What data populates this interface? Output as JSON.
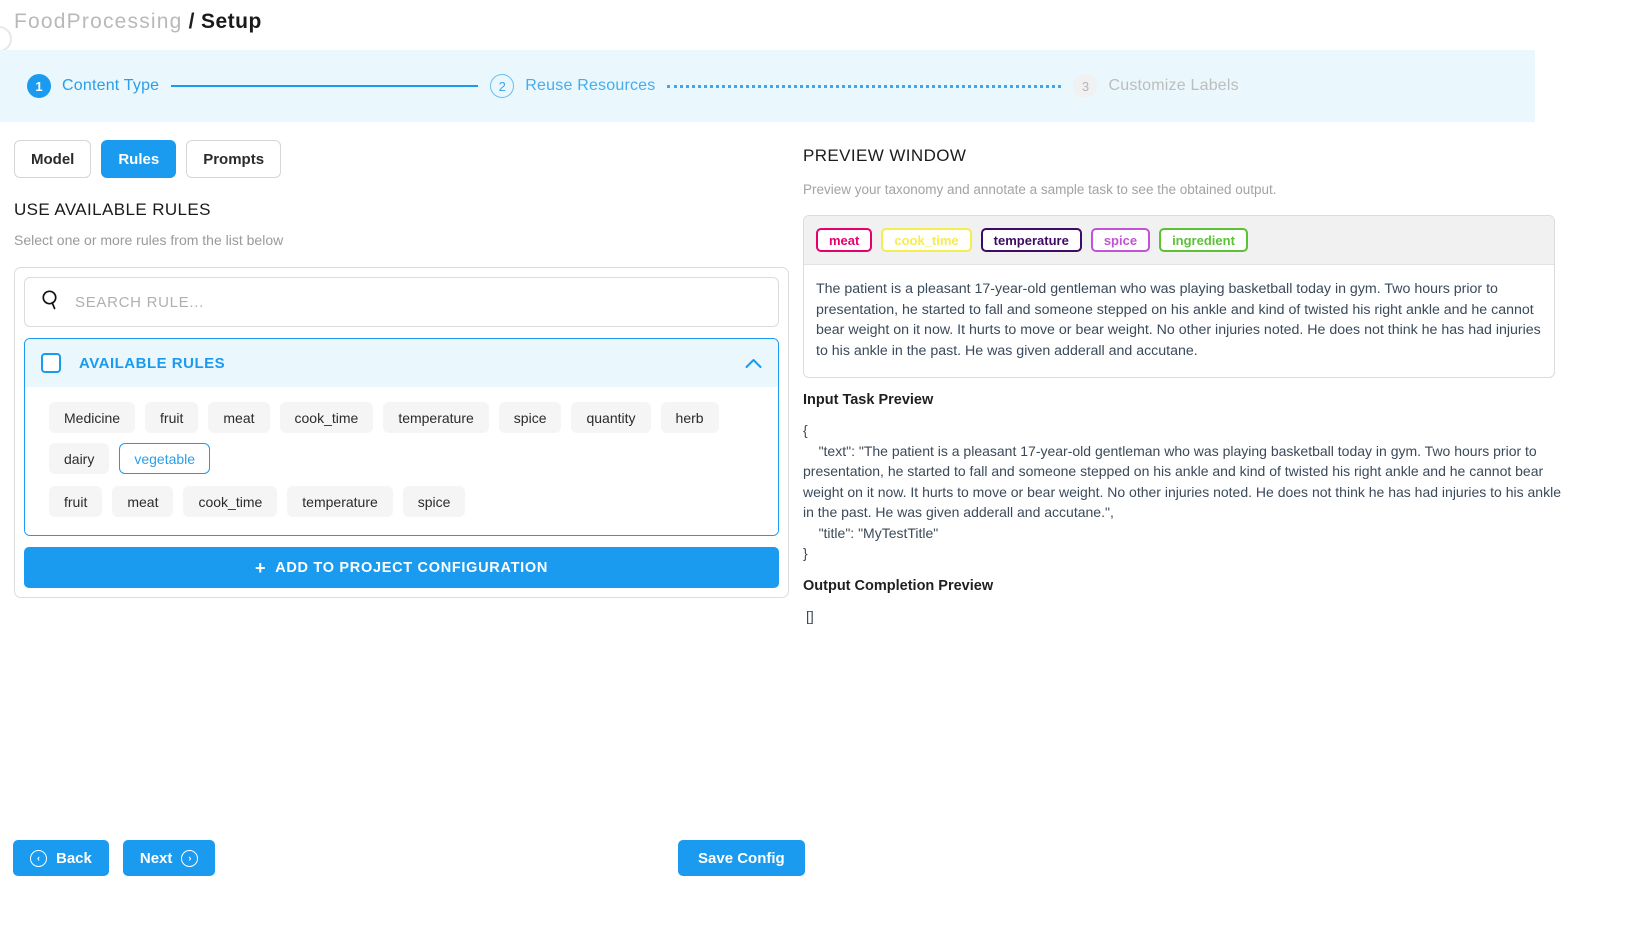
{
  "breadcrumb": {
    "project": "FoodProcessing",
    "separator": "/",
    "current": "Setup"
  },
  "stepper": {
    "steps": [
      {
        "num": "1",
        "label": "Content Type",
        "state": "done"
      },
      {
        "num": "2",
        "label": "Reuse Resources",
        "state": "current"
      },
      {
        "num": "3",
        "label": "Customize Labels",
        "state": "todo"
      }
    ]
  },
  "tabs": [
    {
      "label": "Model",
      "active": false
    },
    {
      "label": "Rules",
      "active": true
    },
    {
      "label": "Prompts",
      "active": false
    }
  ],
  "left": {
    "section_title": "USE AVAILABLE RULES",
    "section_sub": "Select one or more rules from the list below",
    "search": {
      "placeholder": "SEARCH RULE...",
      "value": ""
    },
    "available_rules_header": "AVAILABLE RULES",
    "chevron": "⌃",
    "chips_row1": [
      "Medicine",
      "fruit",
      "meat",
      "cook_time",
      "temperature",
      "spice",
      "quantity",
      "herb",
      "dairy",
      "vegetable"
    ],
    "chips_row1_selected": [
      "vegetable"
    ],
    "chips_row2": [
      "fruit",
      "meat",
      "cook_time",
      "temperature",
      "spice"
    ],
    "add_button": "ADD TO PROJECT CONFIGURATION",
    "add_button_icon": "+"
  },
  "right": {
    "preview_title": "PREVIEW WINDOW",
    "preview_sub": "Preview your taxonomy and annotate a sample task to see the obtained output.",
    "labels": [
      {
        "name": "meat",
        "color": "#e5006d"
      },
      {
        "name": "cook_time",
        "color": "#f4ed50"
      },
      {
        "name": "temperature",
        "color": "#3d0a66"
      },
      {
        "name": "spice",
        "color": "#c154d6"
      },
      {
        "name": "ingredient",
        "color": "#5bc236"
      }
    ],
    "sample_text": "The patient is a pleasant 17-year-old gentleman who was playing basketball today in gym. Two hours prior to presentation, he started to fall and someone stepped on his ankle and kind of twisted his right ankle and he cannot bear weight on it now. It hurts to move or bear weight. No other injuries noted. He does not think he has had injuries to his ankle in the past. He was given adderall and accutane.",
    "input_preview_heading": "Input Task Preview",
    "input_preview_json": "{\n    \"text\": \"The patient is a pleasant 17-year-old gentleman who was playing basketball today in gym. Two hours prior to presentation, he started to fall and someone stepped on his ankle and kind of twisted his right ankle and he cannot bear weight on it now. It hurts to move or bear weight. No other injuries noted. He does not think he has had injuries to his ankle in the past. He was given adderall and accutane.\",\n    \"title\": \"MyTestTitle\"\n}",
    "output_preview_heading": "Output Completion Preview",
    "output_preview_json": "[]"
  },
  "footer": {
    "back": "Back",
    "next": "Next",
    "save": "Save Config",
    "back_icon": "‹",
    "next_icon": "›"
  },
  "colors": {
    "accent": "#1a9bef",
    "banner": "#eaf7fd",
    "chip_bg": "#f5f5f5"
  }
}
